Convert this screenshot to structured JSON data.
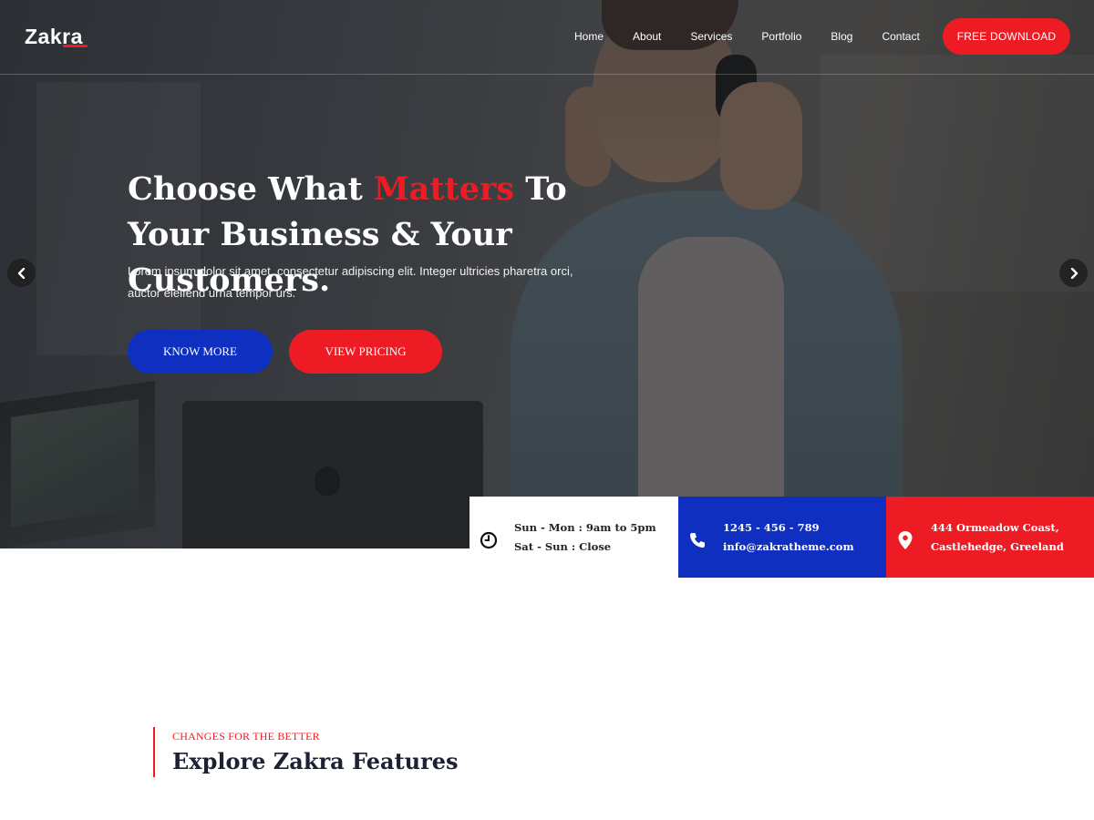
{
  "brand": {
    "logo": "Zakra",
    "accent_red": "#ed1c24",
    "accent_blue": "#0e2fbf"
  },
  "nav": {
    "items": [
      {
        "label": "Home"
      },
      {
        "label": "About"
      },
      {
        "label": "Services"
      },
      {
        "label": "Portfolio"
      },
      {
        "label": "Blog"
      },
      {
        "label": "Contact"
      }
    ],
    "cta_label": "FREE DOWNLOAD"
  },
  "hero": {
    "headline_part1": "Choose What ",
    "headline_accent": "Matters",
    "headline_part2": " To Your Business & Your Customers.",
    "subtext": "Lorem ipsum dolor sit amet, consectetur adipiscing elit. Integer ultricies pharetra orci, auctor eleifend urna tempor urs.",
    "btn_primary": "KNOW MORE",
    "btn_secondary": "VIEW PRICING",
    "prev_icon": "chevron-left-icon",
    "next_icon": "chevron-right-icon"
  },
  "info": {
    "hours": {
      "icon": "clock-icon",
      "line1": "Sun - Mon : 9am to 5pm",
      "line2": "Sat - Sun : Close"
    },
    "contact": {
      "icon": "phone-icon",
      "line1": "1245 - 456 - 789",
      "line2": "info@zakratheme.com"
    },
    "address": {
      "icon": "map-pin-icon",
      "line1": "444 Ormeadow Coast,",
      "line2": "Castlehedge, Greeland"
    }
  },
  "features": {
    "kicker": "CHANGES FOR THE BETTER",
    "title": "Explore Zakra Features"
  }
}
